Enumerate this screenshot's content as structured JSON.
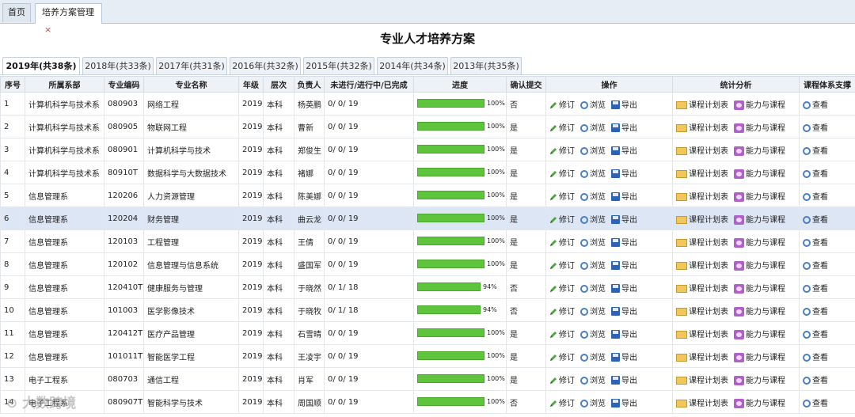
{
  "top_tabs": [
    {
      "label": "首页"
    },
    {
      "label": "培养方案管理",
      "close": "×"
    }
  ],
  "page_title": "专业人才培养方案",
  "year_tabs": [
    {
      "label": "2019年(共38条)",
      "active": true
    },
    {
      "label": "2018年(共33条)"
    },
    {
      "label": "2017年(共31条)"
    },
    {
      "label": "2016年(共32条)"
    },
    {
      "label": "2015年(共32条)"
    },
    {
      "label": "2014年(共34条)"
    },
    {
      "label": "2013年(共35条)"
    }
  ],
  "columns": [
    "序号",
    "所属系部",
    "专业编码",
    "专业名称",
    "年级",
    "层次",
    "负责人",
    "未进行/进行中/已完成",
    "进度",
    "确认提交",
    "操作",
    "统计分析",
    "课程体系支撑"
  ],
  "actions": {
    "edit": "修订",
    "view": "浏览",
    "export": "导出",
    "plan": "课程计划表",
    "ability": "能力与课程",
    "check": "查看"
  },
  "colors": {
    "progress_bar": "#5ec43b",
    "selected_row": "#dde6f5",
    "header_bg": "#eef1f5"
  },
  "rows": [
    {
      "no": "1",
      "dept": "计算机科学与技术系",
      "code": "080903",
      "name": "网络工程",
      "grade": "2019",
      "level": "本科",
      "owner": "杨英鹏",
      "status": "0/ 0/ 19",
      "progress": 1.0,
      "progress_label": "100%",
      "confirmed": "否"
    },
    {
      "no": "2",
      "dept": "计算机科学与技术系",
      "code": "080905",
      "name": "物联网工程",
      "grade": "2019",
      "level": "本科",
      "owner": "曹新",
      "status": "0/ 0/ 19",
      "progress": 1.0,
      "progress_label": "100%",
      "confirmed": "是"
    },
    {
      "no": "3",
      "dept": "计算机科学与技术系",
      "code": "080901",
      "name": "计算机科学与技术",
      "grade": "2019",
      "level": "本科",
      "owner": "郑俊生",
      "status": "0/ 0/ 19",
      "progress": 1.0,
      "progress_label": "100%",
      "confirmed": "是"
    },
    {
      "no": "4",
      "dept": "计算机科学与技术系",
      "code": "80910T",
      "name": "数据科学与大数据技术",
      "grade": "2019",
      "level": "本科",
      "owner": "褚娜",
      "status": "0/ 0/ 19",
      "progress": 1.0,
      "progress_label": "100%",
      "confirmed": "是"
    },
    {
      "no": "5",
      "dept": "信息管理系",
      "code": "120206",
      "name": "人力资源管理",
      "grade": "2019",
      "level": "本科",
      "owner": "陈美娜",
      "status": "0/ 0/ 19",
      "progress": 1.0,
      "progress_label": "100%",
      "confirmed": "是"
    },
    {
      "no": "6",
      "dept": "信息管理系",
      "code": "120204",
      "name": "财务管理",
      "grade": "2019",
      "level": "本科",
      "owner": "曲云龙",
      "status": "0/ 0/ 19",
      "progress": 1.0,
      "progress_label": "100%",
      "confirmed": "是",
      "selected": true
    },
    {
      "no": "7",
      "dept": "信息管理系",
      "code": "120103",
      "name": "工程管理",
      "grade": "2019",
      "level": "本科",
      "owner": "王倩",
      "status": "0/ 0/ 19",
      "progress": 1.0,
      "progress_label": "100%",
      "confirmed": "是"
    },
    {
      "no": "8",
      "dept": "信息管理系",
      "code": "120102",
      "name": "信息管理与信息系统",
      "grade": "2019",
      "level": "本科",
      "owner": "盛国军",
      "status": "0/ 0/ 19",
      "progress": 1.0,
      "progress_label": "100%",
      "confirmed": "是"
    },
    {
      "no": "9",
      "dept": "信息管理系",
      "code": "120410T",
      "name": "健康服务与管理",
      "grade": "2019",
      "level": "本科",
      "owner": "于晓然",
      "status": "0/ 1/ 18",
      "progress": 0.94,
      "progress_label": "94%",
      "confirmed": "否"
    },
    {
      "no": "10",
      "dept": "信息管理系",
      "code": "101003",
      "name": "医学影像技术",
      "grade": "2019",
      "level": "本科",
      "owner": "于晓牧",
      "status": "0/ 1/ 18",
      "progress": 0.94,
      "progress_label": "94%",
      "confirmed": "否"
    },
    {
      "no": "11",
      "dept": "信息管理系",
      "code": "120412T",
      "name": "医疗产品管理",
      "grade": "2019",
      "level": "本科",
      "owner": "石雪晴",
      "status": "0/ 0/ 19",
      "progress": 1.0,
      "progress_label": "100%",
      "confirmed": "是"
    },
    {
      "no": "12",
      "dept": "信息管理系",
      "code": "101011T",
      "name": "智能医学工程",
      "grade": "2019",
      "level": "本科",
      "owner": "王凌宇",
      "status": "0/ 0/ 19",
      "progress": 1.0,
      "progress_label": "100%",
      "confirmed": "是"
    },
    {
      "no": "13",
      "dept": "电子工程系",
      "code": "080703",
      "name": "通信工程",
      "grade": "2019",
      "level": "本科",
      "owner": "肖军",
      "status": "0/ 0/ 19",
      "progress": 1.0,
      "progress_label": "100%",
      "confirmed": "是"
    },
    {
      "no": "14",
      "dept": "电子工程系",
      "code": "080907T",
      "name": "智能科学与技术",
      "grade": "2019",
      "level": "本科",
      "owner": "周国顺",
      "status": "0/ 0/ 19",
      "progress": 1.0,
      "progress_label": "100%",
      "confirmed": "否"
    }
  ]
}
